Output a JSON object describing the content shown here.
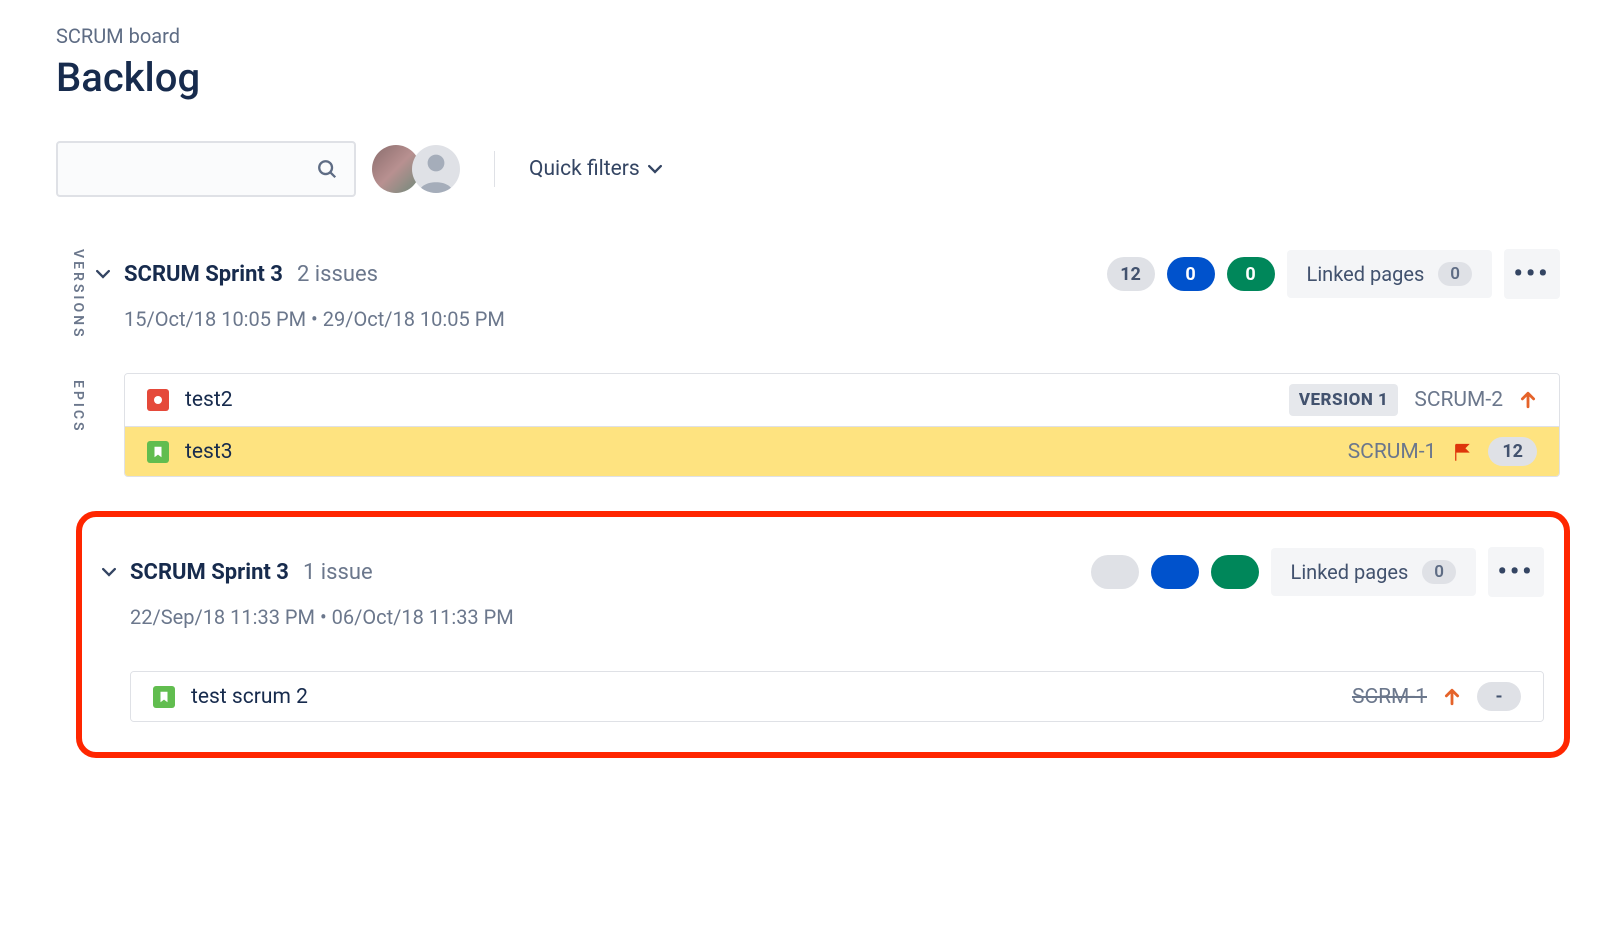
{
  "breadcrumb": "SCRUM board",
  "page_title": "Backlog",
  "search": {
    "placeholder": ""
  },
  "quick_filters_label": "Quick filters",
  "sidebar_tabs": {
    "versions": "VERSIONS",
    "epics": "EPICS"
  },
  "linked_pages_label": "Linked pages",
  "sprints": [
    {
      "name": "SCRUM Sprint 3",
      "issue_count_label": "2 issues",
      "start_date": "15/Oct/18 10:05 PM",
      "end_date": "29/Oct/18 10:05 PM",
      "counts": {
        "gray": "12",
        "blue": "0",
        "green": "0"
      },
      "linked_pages_count": "0",
      "issues": [
        {
          "icon_type": "bug",
          "title": "test2",
          "version_tag": "VERSION 1",
          "key": "SCRUM-2",
          "priority": "highest",
          "flagged": false,
          "estimate": null
        },
        {
          "icon_type": "story",
          "title": "test3",
          "version_tag": null,
          "key": "SCRUM-1",
          "priority": null,
          "flagged": true,
          "estimate": "12"
        }
      ]
    },
    {
      "name": "SCRUM Sprint 3",
      "issue_count_label": "1 issue",
      "start_date": "22/Sep/18 11:33 PM",
      "end_date": "06/Oct/18 11:33 PM",
      "counts": {
        "gray": "",
        "blue": "",
        "green": ""
      },
      "linked_pages_count": "0",
      "issues": [
        {
          "icon_type": "story",
          "title": "test scrum 2",
          "version_tag": null,
          "key": "SCRM-1",
          "key_done": true,
          "priority": "highest",
          "flagged": false,
          "estimate": "-"
        }
      ]
    }
  ]
}
